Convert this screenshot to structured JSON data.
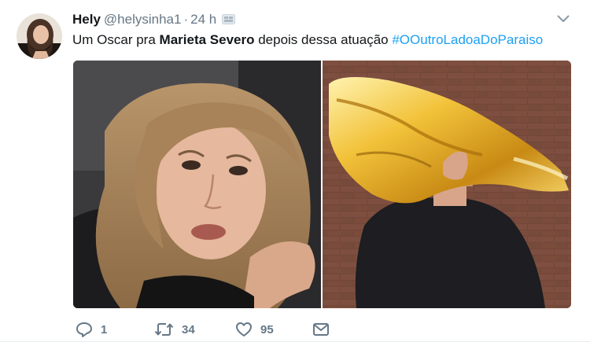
{
  "tweet": {
    "author": {
      "name": "Hely",
      "handle": "@helysinha1",
      "avatar_icon": "user-avatar-photo"
    },
    "separator": "·",
    "timestamp": "24 h",
    "text_parts": {
      "before": "Um Oscar pra ",
      "bold": "Marieta Severo",
      "middle": " depois dessa atuação ",
      "hashtag": "#OOutroLadoaDoParaiso"
    },
    "media": {
      "left_image": "woman-with-distressed-expression",
      "right_image": "person-carrying-giant-golden-oscar-statue"
    },
    "actions": {
      "reply": {
        "icon": "reply-icon",
        "count": "1"
      },
      "retweet": {
        "icon": "retweet-icon",
        "count": "34"
      },
      "like": {
        "icon": "heart-icon",
        "count": "95"
      },
      "dm": {
        "icon": "envelope-icon"
      }
    },
    "colors": {
      "link": "#1da1f2",
      "muted": "#657786",
      "text": "#14171a"
    }
  }
}
